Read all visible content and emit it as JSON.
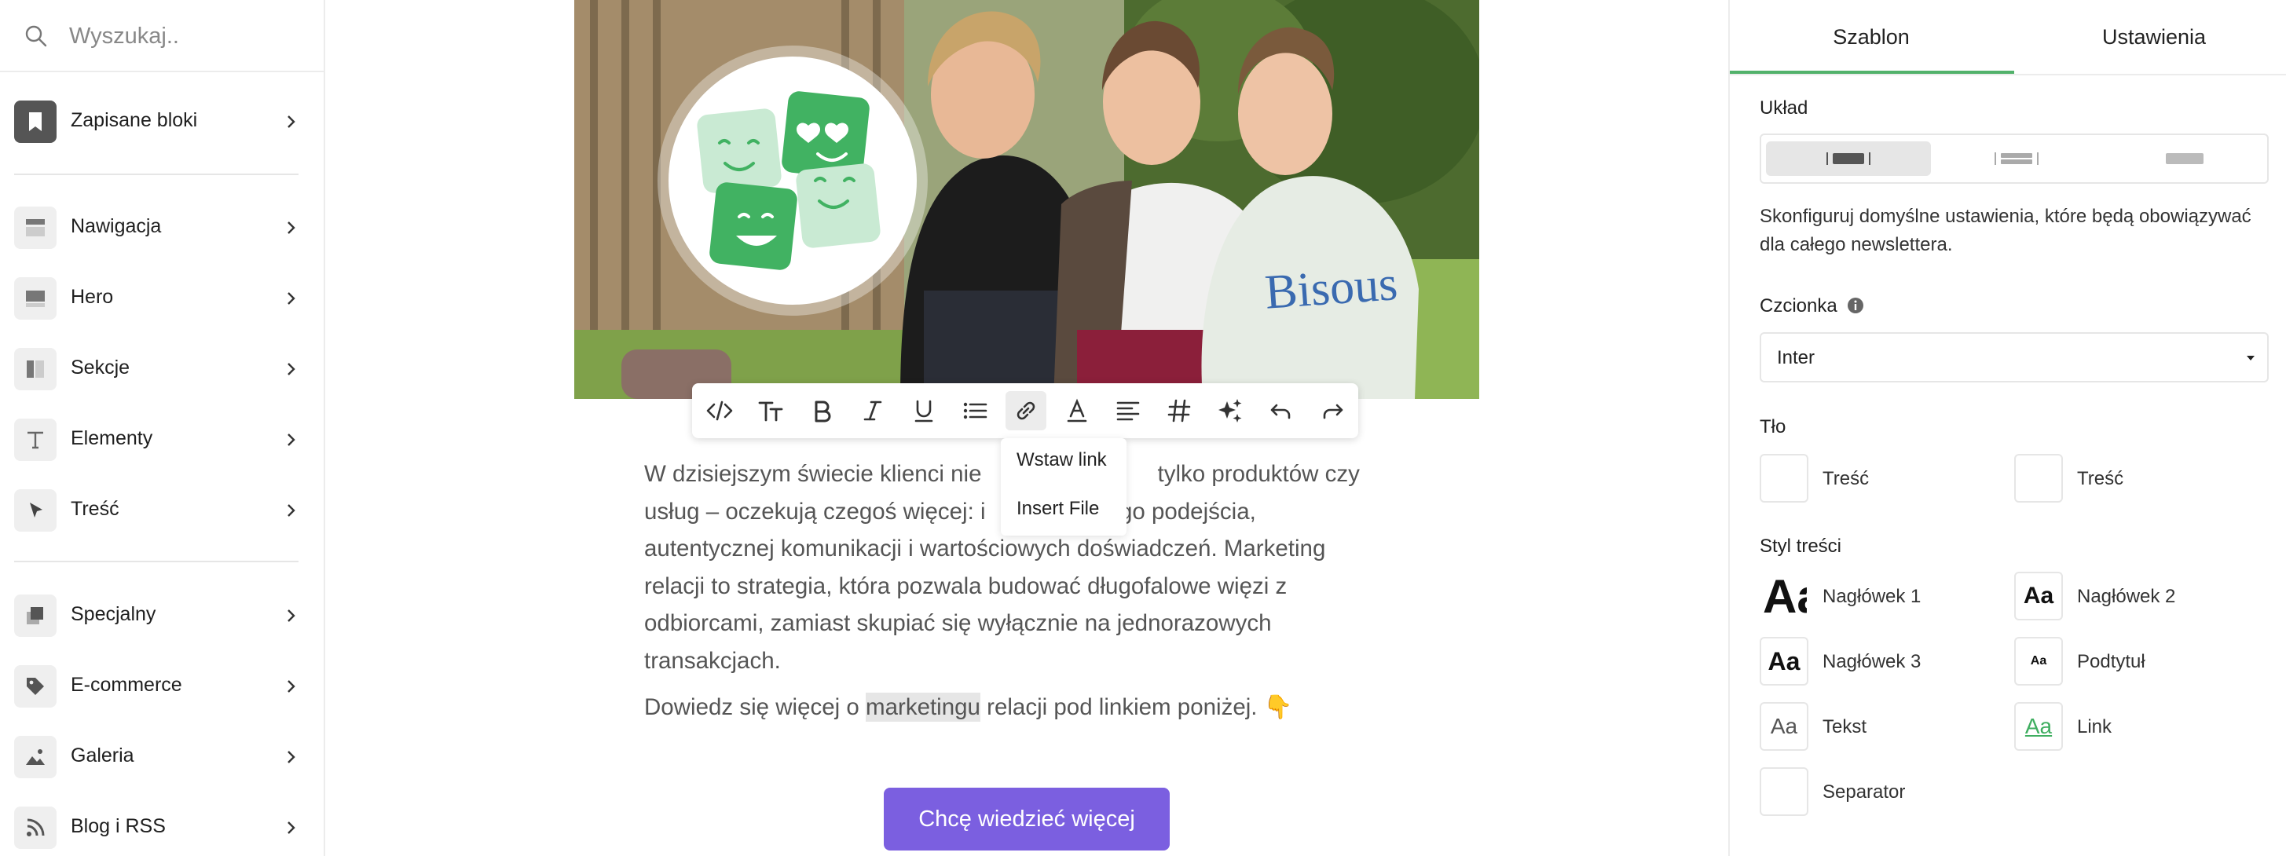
{
  "search": {
    "placeholder": "Wyszukaj.."
  },
  "sidebar": {
    "items": [
      {
        "label": "Zapisane bloki",
        "icon": "bookmark-icon"
      },
      {
        "label": "Nawigacja",
        "icon": "navigation-layout-icon"
      },
      {
        "label": "Hero",
        "icon": "hero-layout-icon"
      },
      {
        "label": "Sekcje",
        "icon": "sections-layout-icon"
      },
      {
        "label": "Elementy",
        "icon": "text-t-icon"
      },
      {
        "label": "Treść",
        "icon": "cursor-icon"
      },
      {
        "label": "Specjalny",
        "icon": "special-copy-icon"
      },
      {
        "label": "E-commerce",
        "icon": "tag-icon"
      },
      {
        "label": "Galeria",
        "icon": "image-icon"
      },
      {
        "label": "Blog i RSS",
        "icon": "rss-icon"
      }
    ]
  },
  "toolbar": {
    "buttons": [
      "code-icon",
      "text-size-icon",
      "bold-icon",
      "italic-icon",
      "underline-icon",
      "list-icon",
      "link-icon",
      "text-color-icon",
      "align-icon",
      "hashtag-icon",
      "ai-sparkle-icon",
      "undo-icon",
      "redo-icon"
    ],
    "active": "link-icon"
  },
  "link_menu": {
    "insert_link": "Wstaw link",
    "insert_file": "Insert File"
  },
  "content": {
    "paragraph1_lines": [
      "W dzisiejszym świecie klienci nie",
      "tylko produktów czy",
      "usług – oczekują czegoś więcej: i",
      "ego podejścia,",
      "autentycznej komunikacji i wartościowych doświadczeń. Marketing",
      "relacji to strategia, która pozwala budować długofalowe więzi z",
      "odbiorcami, zamiast skupiać się wyłącznie na jednorazowych",
      "transakcjach."
    ],
    "paragraph2_before": "Dowiedz się więcej o ",
    "paragraph2_highlight": "marketingu",
    "paragraph2_after": " relacji pod linkiem poniżej. 👇",
    "cta_label": "Chcę wiedzieć więcej"
  },
  "panel": {
    "tabs": [
      "Szablon",
      "Ustawienia"
    ],
    "active_tab": "Szablon",
    "layout_title": "Układ",
    "layout_selected": 0,
    "description": "Skonfiguruj domyślne ustawienia, które będą obowiązywać dla całego newslettera.",
    "font_title": "Czcionka",
    "font_value": "Inter",
    "bg_title": "Tło",
    "bg_items": [
      "Treść",
      "Treść"
    ],
    "style_title": "Styl treści",
    "style_items": [
      {
        "label": "Nagłówek 1",
        "sample": "Aa"
      },
      {
        "label": "Nagłówek 2",
        "sample": "Aa"
      },
      {
        "label": "Nagłówek 3",
        "sample": "Aa"
      },
      {
        "label": "Podtytuł",
        "sample": "Aa"
      },
      {
        "label": "Tekst",
        "sample": "Aa"
      },
      {
        "label": "Link",
        "sample": "Aa"
      },
      {
        "label": "Separator",
        "sample": ""
      }
    ]
  },
  "colors": {
    "accent": "#52b26b",
    "cta": "#7b5fe0",
    "link": "#3fae60"
  }
}
